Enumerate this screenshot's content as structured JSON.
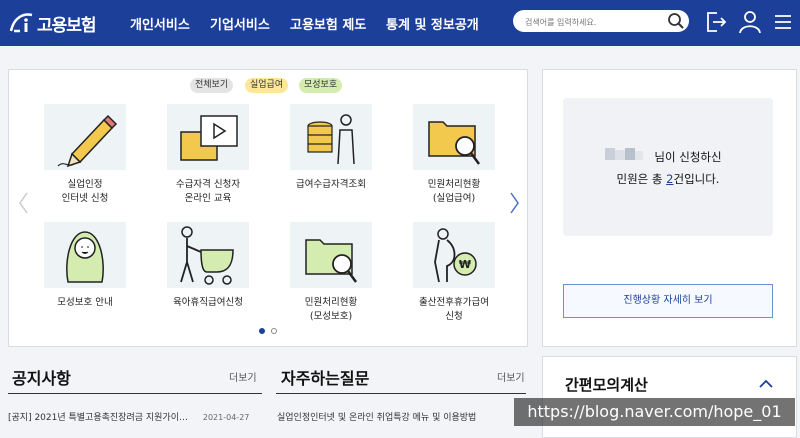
{
  "header": {
    "logo_text": "고용보험",
    "nav": [
      "개인서비스",
      "기업서비스",
      "고용보험 제도",
      "통계 및 정보공개"
    ],
    "search_placeholder": "검색어를 입력하세요."
  },
  "filters": [
    "전체보기",
    "실업급여",
    "모성보호"
  ],
  "services": [
    "실업인정\n인터넷 신청",
    "수급자격 신청자\n온라인 교육",
    "급여수급자격조회",
    "민원처리현황\n(실업급여)",
    "모성보호 안내",
    "육아휴직급여신청",
    "민원처리현황\n(모성보호)",
    "출산전후휴가급여\n신청"
  ],
  "status": {
    "line1": "님이 신청하신",
    "line2_pre": "민원은 총 ",
    "count": "2",
    "line2_post": "건입니다.",
    "detail_button": "진행상황 자세히 보기"
  },
  "notice": {
    "title": "공지사항",
    "more": "더보기",
    "item_title": "[공지] 2021년 특별고용촉진장려금 지원가이…",
    "item_date": "2021-04-27"
  },
  "faq": {
    "title": "자주하는질문",
    "more": "더보기",
    "item_title": "실업인정인터넷 및 온라인 취업특강 메뉴 및 이용방법"
  },
  "calc": {
    "title": "간편모의계산"
  },
  "watermark": "https://blog.naver.com/hope_01",
  "colors": {
    "brand": "#1c3f9a",
    "filter_all": "#e4e4e4",
    "filter_unemp": "#fde59a",
    "filter_mat": "#d4ecb0",
    "dot_active": "#1c3f9a"
  },
  "carousel": {
    "active_page": 1,
    "pages": 2
  }
}
